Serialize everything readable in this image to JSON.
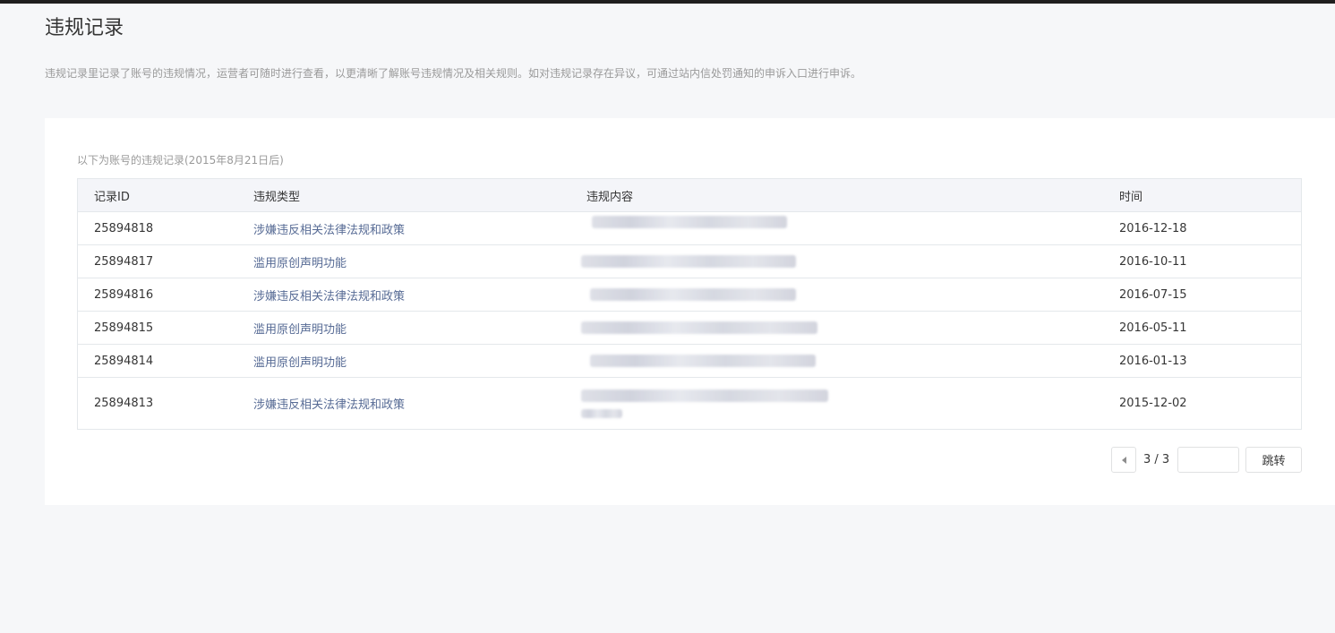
{
  "page": {
    "title": "违规记录",
    "description": "违规记录里记录了账号的违规情况，运营者可随时进行查看，以更清晰了解账号违规情况及相关规则。如对违规记录存在异议，可通过站内信处罚通知的申诉入口进行申诉。"
  },
  "panel": {
    "subtitle": "以下为账号的违规记录(2015年8月21日后)"
  },
  "table": {
    "headers": {
      "id": "记录ID",
      "type": "违规类型",
      "content": "违规内容",
      "time": "时间"
    },
    "rows": [
      {
        "id": "25894818",
        "type": "涉嫌违反相关法律法规和政策",
        "time": "2016-12-18"
      },
      {
        "id": "25894817",
        "type": "滥用原创声明功能",
        "time": "2016-10-11"
      },
      {
        "id": "25894816",
        "type": "涉嫌违反相关法律法规和政策",
        "time": "2016-07-15"
      },
      {
        "id": "25894815",
        "type": "滥用原创声明功能",
        "time": "2016-05-11"
      },
      {
        "id": "25894814",
        "type": "滥用原创声明功能",
        "time": "2016-01-13"
      },
      {
        "id": "25894813",
        "type": "涉嫌违反相关法律法规和政策",
        "time": "2015-12-02"
      }
    ]
  },
  "pagination": {
    "info": "3 / 3",
    "input_value": "",
    "jump_label": "跳转"
  },
  "colors": {
    "link": "#576b95",
    "top_bar": "#1f1f1f",
    "page_bg": "#f6f7f9"
  }
}
